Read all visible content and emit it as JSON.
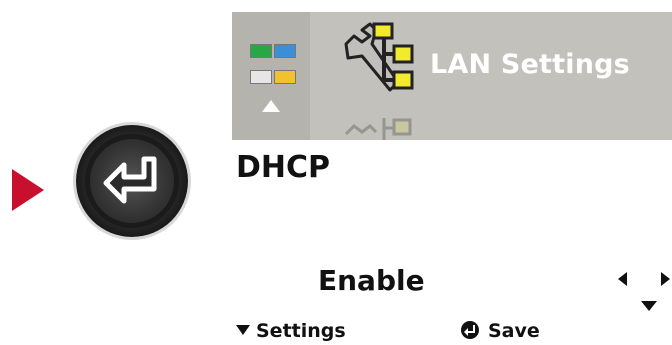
{
  "header": {
    "title": "LAN Settings"
  },
  "setting": {
    "name": "DHCP",
    "value": "Enable"
  },
  "footer": {
    "left_label": "Settings",
    "right_label": "Save"
  },
  "icons": {
    "pointer": "red-triangle-pointer-icon",
    "enter_button": "enter-key-icon",
    "menu": "menu-grid-icon",
    "lan": "lan-settings-icon",
    "nav": "left-down-right-arrows-icon"
  },
  "colors": {
    "pointer": "#c8102e",
    "header_bg": "#c2c1bb",
    "header_text": "#ffffff",
    "network_node": "#f2ea2e"
  }
}
